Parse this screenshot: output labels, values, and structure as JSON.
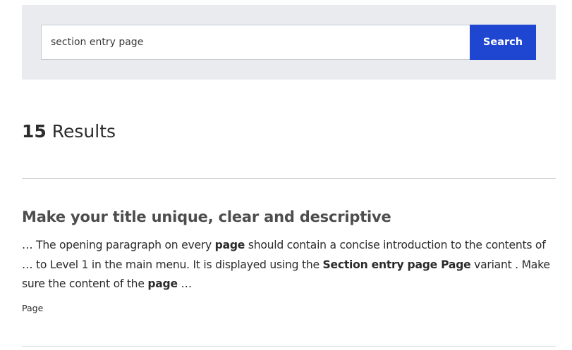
{
  "search": {
    "value": "section entry page",
    "button_label": "Search"
  },
  "results_summary": {
    "count": "15",
    "label": " Results"
  },
  "results": [
    {
      "title": "Make your title unique, clear and descriptive",
      "snippet": {
        "s1": "… The opening paragraph on every ",
        "b1": "page",
        "s2": " should contain a concise introduction to the contents of … to Level 1 in the main menu. It is displayed using the ",
        "b2": "Section entry page Page",
        "s3": " variant . Make sure the content of the ",
        "b3": "page",
        "s4": " …"
      },
      "type": "Page"
    }
  ],
  "colors": {
    "search_band_bg": "#e9ebef",
    "search_button_bg": "#1f46d1",
    "title_color": "#4d4d4d",
    "divider": "#d6d6d6"
  }
}
